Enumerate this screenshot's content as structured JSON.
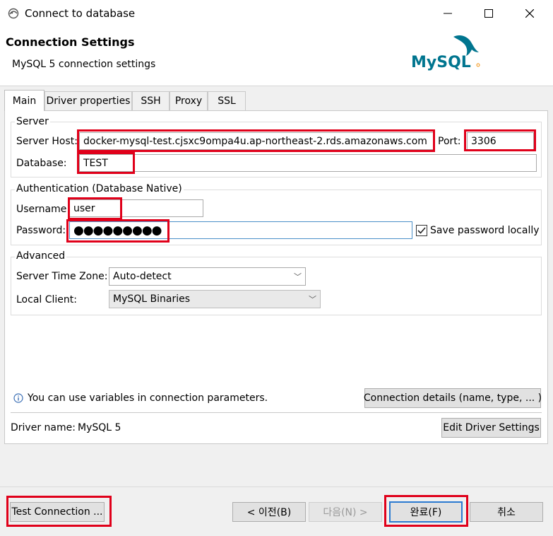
{
  "window": {
    "title": "Connect to database"
  },
  "header": {
    "title": "Connection Settings",
    "subtitle": "MySQL 5 connection settings",
    "logo_text": "MySQL"
  },
  "tabs": [
    "Main",
    "Driver properties",
    "SSH",
    "Proxy",
    "SSL"
  ],
  "server": {
    "legend": "Server",
    "host_label": "Server Host:",
    "host_value": "docker-mysql-test.cjsxc9ompa4u.ap-northeast-2.rds.amazonaws.com",
    "port_label": "Port:",
    "port_value": "3306",
    "database_label": "Database:",
    "database_value": "TEST"
  },
  "auth": {
    "legend": "Authentication (Database Native)",
    "username_label": "Username:",
    "username_value": "user",
    "password_label": "Password:",
    "password_value": "●●●●●●●●●",
    "save_password_label": "Save password locally",
    "save_password_checked": true
  },
  "advanced": {
    "legend": "Advanced",
    "timezone_label": "Server Time Zone:",
    "timezone_value": "Auto-detect",
    "client_label": "Local Client:",
    "client_value": "MySQL Binaries"
  },
  "info": {
    "text": "You can use variables in connection parameters.",
    "details_button": "Connection details (name, type, ... )"
  },
  "driver": {
    "label": "Driver name:",
    "value": "MySQL 5",
    "edit_button": "Edit Driver Settings"
  },
  "footer": {
    "test_button": "Test Connection ...",
    "back_button": "< 이전(B)",
    "next_button": "다음(N) >",
    "finish_button": "완료(F)",
    "cancel_button": "취소"
  },
  "colors": {
    "highlight": "#e0001a",
    "mysql_blue": "#00758f",
    "mysql_orange": "#f29111",
    "focus_blue": "#2b7ad0"
  }
}
